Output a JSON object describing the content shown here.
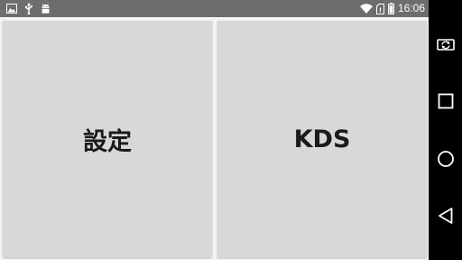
{
  "status_bar": {
    "time": "16:06",
    "background": "#6d6d6d",
    "left_icons": [
      "image-notification-icon",
      "usb-icon",
      "android-debug-icon"
    ],
    "right_icons": [
      "wifi-icon",
      "no-sim-icon",
      "battery-icon"
    ]
  },
  "tiles": [
    {
      "label": "設定"
    },
    {
      "label": "KDS"
    }
  ],
  "nav_bar": {
    "buttons": [
      "rotate-screen-icon",
      "recents-square-icon",
      "home-circle-icon",
      "back-triangle-icon"
    ]
  },
  "colors": {
    "tile_background": "#d7d8d8",
    "content_background": "#f4f4f4",
    "label_text": "#1b1b1b",
    "nav_background": "#000000"
  }
}
